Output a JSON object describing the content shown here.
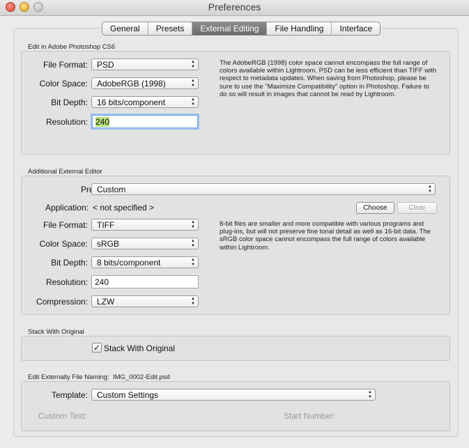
{
  "window": {
    "title": "Preferences"
  },
  "tabs": [
    {
      "label": "General",
      "active": false
    },
    {
      "label": "Presets",
      "active": false
    },
    {
      "label": "External Editing",
      "active": true
    },
    {
      "label": "File Handling",
      "active": false
    },
    {
      "label": "Interface",
      "active": false
    }
  ],
  "photoshop": {
    "section_title": "Edit in Adobe Photoshop CS6",
    "file_format": {
      "label": "File Format:",
      "value": "PSD"
    },
    "color_space": {
      "label": "Color Space:",
      "value": "AdobeRGB (1998)"
    },
    "bit_depth": {
      "label": "Bit Depth:",
      "value": "16 bits/component"
    },
    "resolution": {
      "label": "Resolution:",
      "value": "240"
    },
    "description": "The AdobeRGB (1998) color space cannot encompass the full range of colors available within Lightroom. PSD can be less efficient than TIFF with respect to metadata updates. When saving from Photoshop, please be sure to use the \"Maximize Compatibility\" option in Photoshop. Failure to do so will result in images that cannot be read by Lightroom."
  },
  "additional": {
    "section_title": "Additional External Editor",
    "preset": {
      "label": "Preset:",
      "value": "Custom"
    },
    "application": {
      "label": "Application:",
      "value": "< not specified >"
    },
    "choose_label": "Choose",
    "clear_label": "Clear",
    "file_format": {
      "label": "File Format:",
      "value": "TIFF"
    },
    "color_space": {
      "label": "Color Space:",
      "value": "sRGB"
    },
    "bit_depth": {
      "label": "Bit Depth:",
      "value": "8 bits/component"
    },
    "resolution": {
      "label": "Resolution:",
      "value": "240"
    },
    "compression": {
      "label": "Compression:",
      "value": "LZW"
    },
    "description": "8-bit files are smaller and more compatible with various programs and plug-ins, but will not preserve fine tonal detail as well as 16-bit data. The sRGB color space cannot encompass the full range of colors available within Lightroom."
  },
  "stack": {
    "section_title": "Stack With Original",
    "checkbox_label": "Stack With Original",
    "checked": true,
    "check_glyph": "✓"
  },
  "naming": {
    "section_title": "Edit Externally File Naming:",
    "example": "IMG_0002-Edit.psd",
    "template": {
      "label": "Template:",
      "value": "Custom Settings"
    },
    "custom_text_label": "Custom Text:",
    "start_number_label": "Start Number:"
  },
  "icons": {
    "popup_up": "▲",
    "popup_down": "▼"
  }
}
